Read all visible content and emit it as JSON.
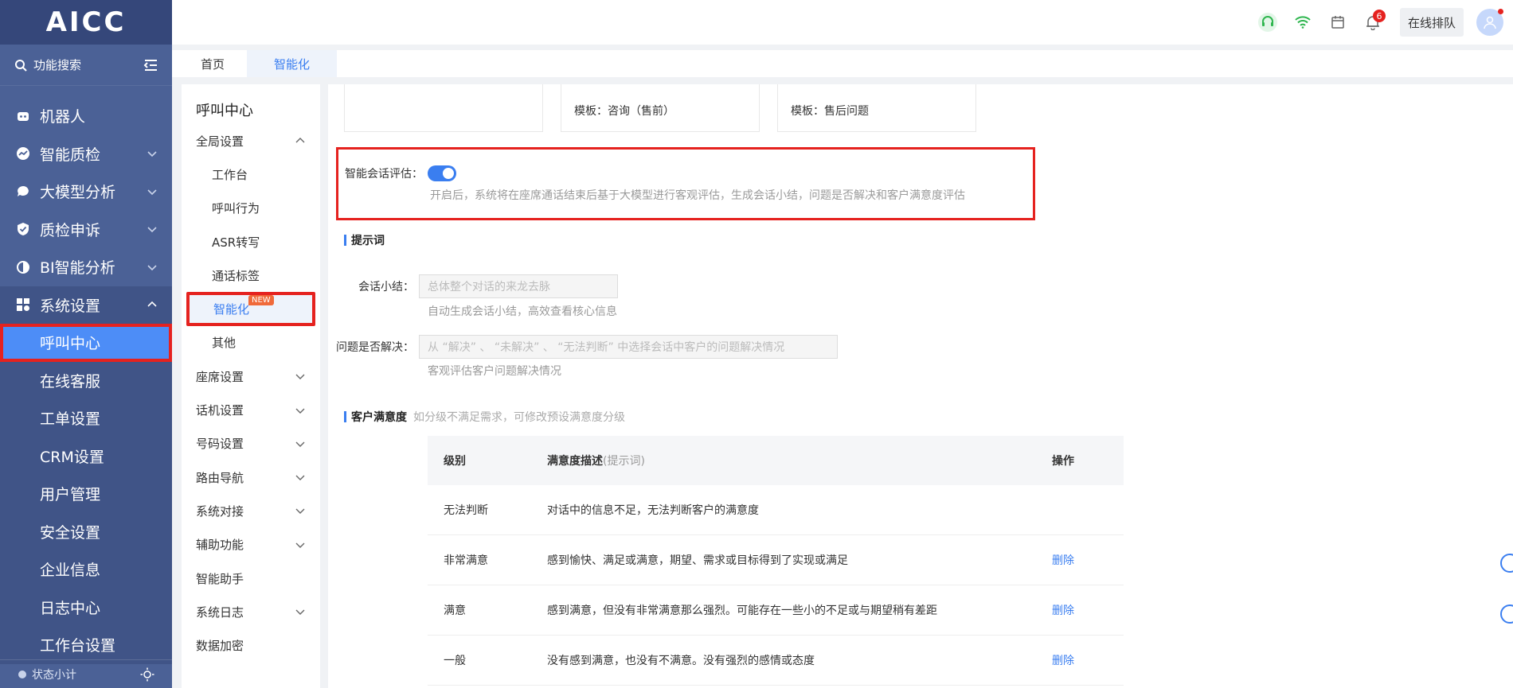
{
  "app": {
    "logo": "AICC"
  },
  "sidebar": {
    "search_label": "功能搜索",
    "items": [
      {
        "label": "机器人",
        "icon": "robot-icon",
        "chevron": false
      },
      {
        "label": "智能质检",
        "icon": "chart-icon",
        "chevron": true
      },
      {
        "label": "大模型分析",
        "icon": "chat-icon",
        "chevron": true
      },
      {
        "label": "质检申诉",
        "icon": "shield-check-icon",
        "chevron": true
      },
      {
        "label": "BI智能分析",
        "icon": "pie-icon",
        "chevron": true
      },
      {
        "label": "系统设置",
        "icon": "grid-icon",
        "chevron": true,
        "open": true
      }
    ],
    "subitems": [
      "呼叫中心",
      "在线客服",
      "工单设置",
      "CRM设置",
      "用户管理",
      "安全设置",
      "企业信息",
      "日志中心",
      "工作台设置"
    ],
    "active_subitem": "呼叫中心",
    "footer_label": "状态小计"
  },
  "topbar": {
    "notification_count": "6",
    "online_queue_label": "在线排队"
  },
  "tabs": [
    {
      "label": "首页",
      "active": false
    },
    {
      "label": "智能化",
      "active": true
    }
  ],
  "subnav": {
    "title": "呼叫中心",
    "global_settings": "全局设置",
    "children": [
      "工作台",
      "呼叫行为",
      "ASR转写",
      "通话标签"
    ],
    "active_child": "智能化",
    "new_tag": "NEW",
    "other": "其他",
    "groups": [
      {
        "label": "座席设置",
        "chevron": true
      },
      {
        "label": "话机设置",
        "chevron": true
      },
      {
        "label": "号码设置",
        "chevron": true
      },
      {
        "label": "路由导航",
        "chevron": true
      },
      {
        "label": "系统对接",
        "chevron": true
      },
      {
        "label": "辅助功能",
        "chevron": true
      },
      {
        "label": "智能助手",
        "chevron": false
      },
      {
        "label": "系统日志",
        "chevron": true
      },
      {
        "label": "数据加密",
        "chevron": false
      }
    ]
  },
  "main": {
    "templates": [
      "",
      "模板：咨询（售前）",
      "模板：售后问题"
    ],
    "eval": {
      "label": "智能会话评估：",
      "enabled": true,
      "desc": "开启后，系统将在座席通话结束后基于大模型进行客观评估，生成会话小结，问题是否解决和客户满意度评估"
    },
    "prompt_section": "提示词",
    "summary": {
      "label": "会话小结：",
      "placeholder": "总体整个对话的来龙去脉",
      "hint": "自动生成会话小结，高效查看核心信息"
    },
    "resolved": {
      "label": "问题是否解决：",
      "placeholder": "从 “解决” 、 “未解决” 、 “无法判断” 中选择会话中客户的问题解决情况",
      "hint": "客观评估客户问题解决情况"
    },
    "satisfaction": {
      "title": "客户满意度",
      "hint": "如分级不满足需求，可修改预设满意度分级",
      "headers": {
        "level": "级别",
        "desc": "满意度描述",
        "desc_hint": "(提示词)",
        "action": "操作"
      },
      "rows": [
        {
          "level": "无法判断",
          "desc": "对话中的信息不足，无法判断客户的满意度",
          "action": ""
        },
        {
          "level": "非常满意",
          "desc": "感到愉快、满足或满意，期望、需求或目标得到了实现或满足",
          "action": "删除"
        },
        {
          "level": "满意",
          "desc": "感到满意，但没有非常满意那么强烈。可能存在一些小的不足或与期望稍有差距",
          "action": "删除"
        },
        {
          "level": "一般",
          "desc": "没有感到满意，也没有不满意。没有强烈的感情或态度",
          "action": "删除"
        }
      ]
    }
  },
  "colors": {
    "sidebar": "#4b6196",
    "accent": "#3a7ef0",
    "highlight_border": "#e5221f"
  }
}
